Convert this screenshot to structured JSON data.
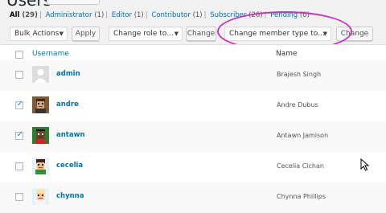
{
  "page": {
    "title": "Users"
  },
  "filters": [
    {
      "label": "All",
      "count": "(29)",
      "current": true
    },
    {
      "label": "Administrator",
      "count": "(1)"
    },
    {
      "label": "Editor",
      "count": "(1)"
    },
    {
      "label": "Contributor",
      "count": "(1)"
    },
    {
      "label": "Subscriber",
      "count": "(26)"
    },
    {
      "label": "Pending",
      "count": "(0)"
    }
  ],
  "toolbar": {
    "bulk_actions": "Bulk Actions",
    "apply": "Apply",
    "change_role": "Change role to…",
    "change": "Change",
    "change_member_type": "Change member type to…",
    "change2": "Change"
  },
  "table": {
    "headers": {
      "username": "Username",
      "name": "Name"
    },
    "rows": [
      {
        "username": "admin",
        "name": "Brajesh Singh",
        "checked": false,
        "avatar": "default-avatar"
      },
      {
        "username": "andre",
        "name": "Andre Dubus",
        "checked": true,
        "avatar": "avatar-andre"
      },
      {
        "username": "antawn",
        "name": "Antawn Jamison",
        "checked": true,
        "avatar": "avatar-antawn"
      },
      {
        "username": "cecelia",
        "name": "Cecelia Cichan",
        "checked": false,
        "avatar": "avatar-cecelia"
      },
      {
        "username": "chynna",
        "name": "Chynna Phillips",
        "checked": false,
        "avatar": "avatar-chynna"
      }
    ]
  },
  "colors": {
    "link": "#0073aa",
    "highlight": "#c335c3",
    "check": "#1e8cbe"
  }
}
